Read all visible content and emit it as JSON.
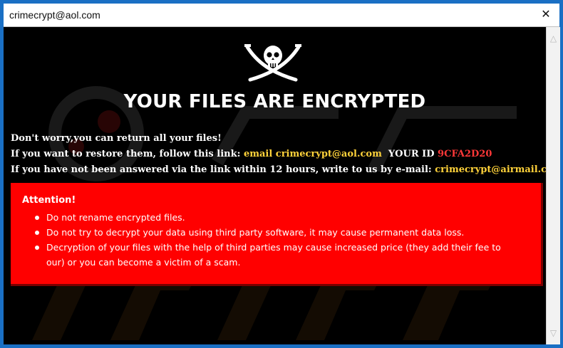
{
  "window": {
    "title": "crimecrypt@aol.com",
    "close_glyph": "✕"
  },
  "icons": {
    "pirate": "skull-crossed-swords-icon",
    "scroll_up": "chevron-up-icon",
    "scroll_down": "chevron-down-icon"
  },
  "note": {
    "headline": "YOUR FILES ARE ENCRYPTED",
    "line1": "Don't worry,you can return all your files!",
    "line2_prefix": "If you want to restore them, follow this link: ",
    "line2_email_label": "email crimecrypt@aol.com",
    "line2_id_label": "  YOUR ID ",
    "line2_id": "9CFA2D20",
    "line3_prefix": "If you have not been answered via the link within 12 hours, write to us by e-mail: ",
    "line3_email": "crimecrypt@airmail.cc",
    "attention_title": "Attention!",
    "attention_items": [
      "Do not rename encrypted files.",
      "Do not try to decrypt your data using third party software, it may cause permanent data loss.",
      "Decryption of your files with the help of third parties may cause increased price (they add their fee to our) or you can become a victim of a scam."
    ]
  },
  "colors": {
    "frame": "#1a6fc4",
    "background": "#000000",
    "accent_yellow": "#ffd23a",
    "id_red": "#ff3838",
    "box_red": "#ff0000"
  }
}
